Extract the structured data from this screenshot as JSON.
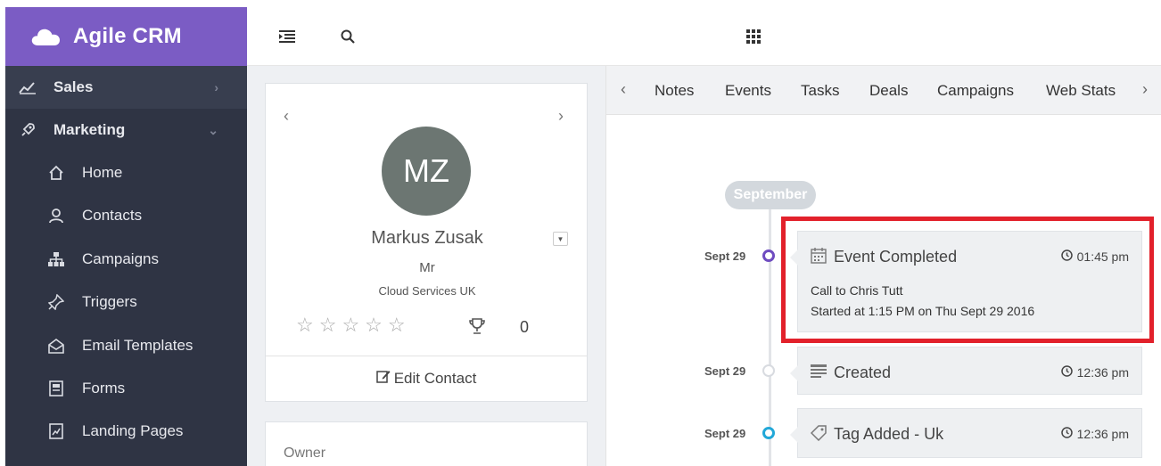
{
  "app": {
    "name": "Agile CRM",
    "brand_color": "#7b5cc4"
  },
  "sidebar": {
    "sections": [
      {
        "label": "Sales",
        "icon": "line-chart-icon",
        "expanded": false
      },
      {
        "label": "Marketing",
        "icon": "rocket-icon",
        "expanded": true
      }
    ],
    "items": [
      {
        "label": "Home",
        "icon": "home-icon"
      },
      {
        "label": "Contacts",
        "icon": "user-icon"
      },
      {
        "label": "Campaigns",
        "icon": "sitemap-icon"
      },
      {
        "label": "Triggers",
        "icon": "push-pin-icon"
      },
      {
        "label": "Email Templates",
        "icon": "envelope-open-icon"
      },
      {
        "label": "Forms",
        "icon": "forms-icon"
      },
      {
        "label": "Landing Pages",
        "icon": "landing-page-icon"
      }
    ]
  },
  "topbar": {
    "icons": [
      "menu-toggle-icon",
      "search-icon",
      "apps-grid-icon"
    ]
  },
  "contact": {
    "initials": "MZ",
    "name": "Markus Zusak",
    "title": "Mr",
    "company": "Cloud Services UK",
    "stars": "☆☆☆☆☆",
    "rating": 0,
    "score": "0",
    "edit_label": "Edit Contact",
    "owner_label": "Owner",
    "avatar_color": "#6c7672"
  },
  "tabs": [
    "Notes",
    "Events",
    "Tasks",
    "Deals",
    "Campaigns",
    "Web Stats"
  ],
  "timeline": {
    "month": "September",
    "events": [
      {
        "date": "Sept 29",
        "title": "Event Completed",
        "time": "01:45 pm",
        "icon": "calendar-icon",
        "dot_color": "#6f4cc0",
        "lines": [
          "Call to Chris Tutt",
          "Started at 1:15 PM on Thu Sept 29 2016"
        ],
        "highlighted": true
      },
      {
        "date": "Sept 29",
        "title": "Created",
        "time": "12:36 pm",
        "icon": "list-icon",
        "dot_color": "#d8dbe0",
        "lines": []
      },
      {
        "date": "Sept 29",
        "title": "Tag Added - Uk",
        "time": "12:36 pm",
        "icon": "tag-icon",
        "dot_color": "#22a8d8",
        "lines": []
      }
    ],
    "highlight_color": "#e2212b"
  }
}
